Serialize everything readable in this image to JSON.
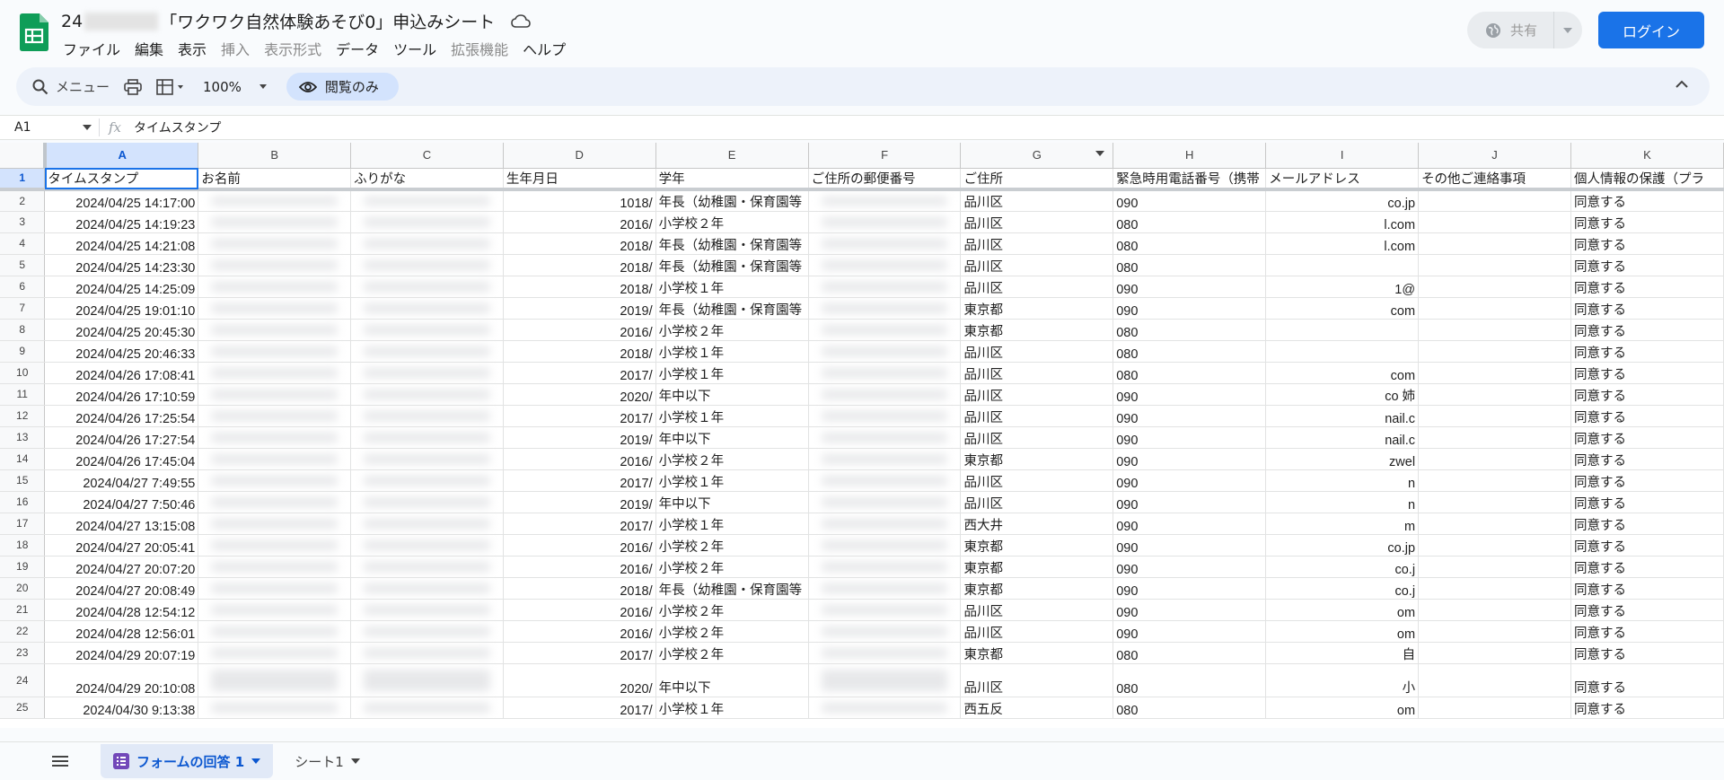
{
  "header": {
    "title_prefix": "24",
    "title_main": "「ワクワク自然体験あそび0」申込みシート",
    "menu": [
      {
        "label": "ファイル",
        "disabled": false
      },
      {
        "label": "編集",
        "disabled": false
      },
      {
        "label": "表示",
        "disabled": false
      },
      {
        "label": "挿入",
        "disabled": true
      },
      {
        "label": "表示形式",
        "disabled": true
      },
      {
        "label": "データ",
        "disabled": false
      },
      {
        "label": "ツール",
        "disabled": false
      },
      {
        "label": "拡張機能",
        "disabled": true
      },
      {
        "label": "ヘルプ",
        "disabled": false
      }
    ],
    "share_label": "共有",
    "login_label": "ログイン"
  },
  "toolbar": {
    "search_label": "メニュー",
    "zoom": "100%",
    "view_only_label": "閲覧のみ"
  },
  "formula_bar": {
    "cell_ref": "A1",
    "fx": "fx",
    "content": "タイムスタンプ"
  },
  "grid": {
    "columns": [
      "A",
      "B",
      "C",
      "D",
      "E",
      "F",
      "G",
      "H",
      "I",
      "J",
      "K"
    ],
    "headers": [
      "タイムスタンプ",
      "お名前",
      "ふりがな",
      "生年月日",
      "学年",
      "ご住所の郵便番号",
      "ご住所",
      "緊急時用電話番号（携帯",
      "メールアドレス",
      "その他ご連絡事項",
      "個人情報の保護（プラ"
    ],
    "rows": [
      {
        "n": "2",
        "ts": "2024/04/25 14:17:00",
        "dob": "1018/",
        "grade": "年長（幼稚園・保育園等",
        "addr": "品川区",
        "tel": "090",
        "mail": "co.jp",
        "note": "",
        "consent": "同意する"
      },
      {
        "n": "3",
        "ts": "2024/04/25 14:19:23",
        "dob": "2016/",
        "grade": "小学校２年",
        "addr": "品川区",
        "tel": "080",
        "mail": "l.com",
        "note": "",
        "consent": "同意する"
      },
      {
        "n": "4",
        "ts": "2024/04/25 14:21:08",
        "dob": "2018/",
        "grade": "年長（幼稚園・保育園等",
        "addr": "品川区",
        "tel": "080",
        "mail": "l.com",
        "note": "",
        "consent": "同意する"
      },
      {
        "n": "5",
        "ts": "2024/04/25 14:23:30",
        "dob": "2018/",
        "grade": "年長（幼稚園・保育園等",
        "addr": "品川区",
        "tel": "080",
        "mail": "",
        "note": "",
        "consent": "同意する"
      },
      {
        "n": "6",
        "ts": "2024/04/25 14:25:09",
        "dob": "2018/",
        "grade": "小学校１年",
        "addr": "品川区",
        "tel": "090",
        "mail": "1@",
        "note": "",
        "consent": "同意する"
      },
      {
        "n": "7",
        "ts": "2024/04/25 19:01:10",
        "dob": "2019/",
        "grade": "年長（幼稚園・保育園等",
        "addr": "東京都",
        "tel": "090",
        "mail": "com",
        "note": "",
        "consent": "同意する"
      },
      {
        "n": "8",
        "ts": "2024/04/25 20:45:30",
        "dob": "2016/",
        "grade": "小学校２年",
        "addr": "東京都",
        "tel": "080",
        "mail": "",
        "note": "",
        "consent": "同意する"
      },
      {
        "n": "9",
        "ts": "2024/04/25 20:46:33",
        "dob": "2018/",
        "grade": "小学校１年",
        "addr": "品川区",
        "tel": "080",
        "mail": "",
        "note": "",
        "consent": "同意する"
      },
      {
        "n": "10",
        "ts": "2024/04/26 17:08:41",
        "dob": "2017/",
        "grade": "小学校１年",
        "addr": "品川区",
        "tel": "080",
        "mail": "com",
        "note": "",
        "consent": "同意する"
      },
      {
        "n": "11",
        "ts": "2024/04/26 17:10:59",
        "dob": "2020/",
        "grade": "年中以下",
        "addr": "品川区",
        "tel": "090",
        "mail": "co 姉",
        "note": "",
        "consent": "同意する"
      },
      {
        "n": "12",
        "ts": "2024/04/26 17:25:54",
        "dob": "2017/",
        "grade": "小学校１年",
        "addr": "品川区",
        "tel": "090",
        "mail": "nail.c",
        "note": "",
        "consent": "同意する"
      },
      {
        "n": "13",
        "ts": "2024/04/26 17:27:54",
        "dob": "2019/",
        "grade": "年中以下",
        "addr": "品川区",
        "tel": "090",
        "mail": "nail.c",
        "note": "",
        "consent": "同意する"
      },
      {
        "n": "14",
        "ts": "2024/04/26 17:45:04",
        "dob": "2016/",
        "grade": "小学校２年",
        "addr": "東京都",
        "tel": "090",
        "mail": "zwel",
        "note": "",
        "consent": "同意する"
      },
      {
        "n": "15",
        "ts": "2024/04/27 7:49:55",
        "dob": "2017/",
        "grade": "小学校１年",
        "addr": "品川区",
        "tel": "090",
        "mail": "n",
        "note": "",
        "consent": "同意する"
      },
      {
        "n": "16",
        "ts": "2024/04/27 7:50:46",
        "dob": "2019/",
        "grade": "年中以下",
        "addr": "品川区",
        "tel": "090",
        "mail": "n",
        "note": "",
        "consent": "同意する"
      },
      {
        "n": "17",
        "ts": "2024/04/27 13:15:08",
        "dob": "2017/",
        "grade": "小学校１年",
        "addr": "西大井",
        "tel": "090",
        "mail": "m",
        "note": "",
        "consent": "同意する"
      },
      {
        "n": "18",
        "ts": "2024/04/27 20:05:41",
        "dob": "2016/",
        "grade": "小学校２年",
        "addr": "東京都",
        "tel": "090",
        "mail": "co.jp",
        "note": "",
        "consent": "同意する"
      },
      {
        "n": "19",
        "ts": "2024/04/27 20:07:20",
        "dob": "2016/",
        "grade": "小学校２年",
        "addr": "東京都",
        "tel": "090",
        "mail": "co.j",
        "note": "",
        "consent": "同意する"
      },
      {
        "n": "20",
        "ts": "2024/04/27 20:08:49",
        "dob": "2018/",
        "grade": "年長（幼稚園・保育園等",
        "addr": "東京都",
        "tel": "090",
        "mail": "co.j",
        "note": "",
        "consent": "同意する"
      },
      {
        "n": "21",
        "ts": "2024/04/28 12:54:12",
        "dob": "2016/",
        "grade": "小学校２年",
        "addr": "品川区",
        "tel": "090",
        "mail": "om",
        "note": "",
        "consent": "同意する"
      },
      {
        "n": "22",
        "ts": "2024/04/28 12:56:01",
        "dob": "2016/",
        "grade": "小学校２年",
        "addr": "品川区",
        "tel": "090",
        "mail": "om",
        "note": "",
        "consent": "同意する"
      },
      {
        "n": "23",
        "ts": "2024/04/29 20:07:19",
        "dob": "2017/",
        "grade": "小学校２年",
        "addr": "東京都",
        "tel": "080",
        "mail": "自",
        "note": "",
        "consent": "同意する"
      },
      {
        "n": "24",
        "ts": "2024/04/29 20:10:08",
        "dob": "2020/",
        "grade": "年中以下",
        "addr": "品川区",
        "tel": "080",
        "mail": "小",
        "note": "",
        "consent": "同意する"
      },
      {
        "n": "25",
        "ts": "2024/04/30 9:13:38",
        "dob": "2017/",
        "grade": "小学校１年",
        "addr": "西五反",
        "tel": "080",
        "mail": "om",
        "note": "",
        "consent": "同意する"
      }
    ]
  },
  "sheets": {
    "active_label": "フォームの回答 1",
    "other_label": "シート1"
  },
  "colors": {
    "accent": "#1a73e8",
    "sheets_green": "#0f9d58",
    "toolbar_bg": "#edf2fa",
    "view_pill": "#d3e3fd"
  }
}
